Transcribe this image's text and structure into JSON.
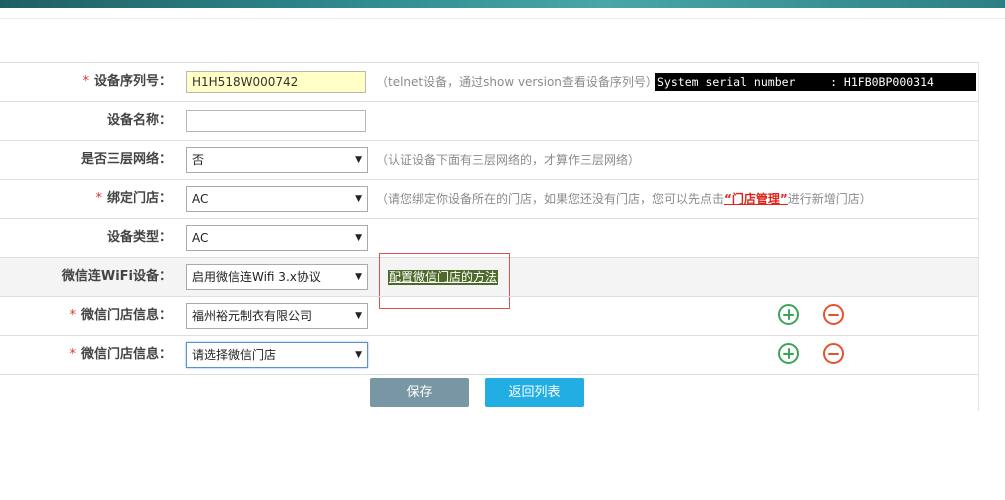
{
  "colors": {
    "accent": "#22aee3",
    "required": "#e0362b",
    "add": "#3aa55a",
    "remove": "#e8512c"
  },
  "form": {
    "serial": {
      "required": "*",
      "label": "设备序列号：",
      "value": "H1H518W000742",
      "hint": "（telnet设备，通过show version查看设备序列号）",
      "terminal_text": "System serial number     : H1FB0BP000314"
    },
    "device_name": {
      "label": "设备名称：",
      "value": ""
    },
    "layer3": {
      "label": "是否三层网络：",
      "selected": "否",
      "hint": "（认证设备下面有三层网络的，才算作三层网络）"
    },
    "bind_store": {
      "required": "*",
      "label": "绑定门店：",
      "selected": "AC",
      "hint_before": "（请您绑定你设备所在的门店，如果您还没有门店，您可以先点击",
      "hint_link": "“门店管理”",
      "hint_after": "进行新增门店）"
    },
    "device_type": {
      "label": "设备类型：",
      "selected": "AC"
    },
    "wechat_wifi": {
      "label": "微信连WiFi设备：",
      "selected": "启用微信连Wifi 3.x协议",
      "link": "配置微信门店的方法"
    },
    "wechat_store_rows": [
      {
        "required": "*",
        "label": "微信门店信息：",
        "selected": "福州裕元制衣有限公司",
        "add_icon": "plus-circle-icon",
        "remove_icon": "minus-circle-icon"
      },
      {
        "required": "*",
        "label": "微信门店信息：",
        "selected": "请选择微信门店",
        "add_icon": "plus-circle-icon",
        "remove_icon": "minus-circle-icon"
      }
    ]
  },
  "buttons": {
    "save": "保存",
    "back": "返回列表"
  },
  "icons": {
    "select_arrow": "▼"
  }
}
